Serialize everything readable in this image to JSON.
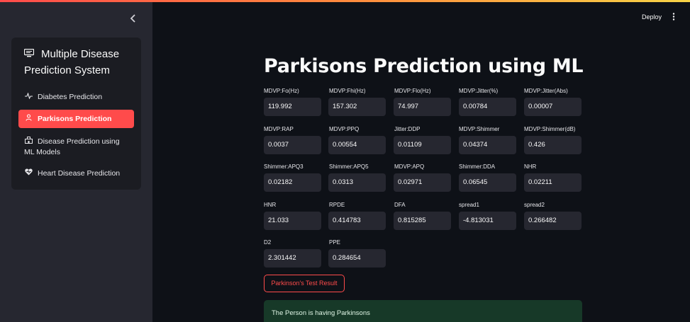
{
  "header": {
    "deploy_label": "Deploy",
    "menu_icon": "kebab-icon"
  },
  "sidebar": {
    "collapse_icon": "chevron-left-icon",
    "menu_title": "Multiple Disease Prediction System",
    "items": [
      {
        "label": "Diabetes Prediction",
        "icon": "activity-icon",
        "active": false
      },
      {
        "label": "Parkisons Prediction",
        "icon": "person-icon",
        "active": true
      },
      {
        "label": "Disease Prediction using ML Models",
        "icon": "hospital-icon",
        "active": false
      },
      {
        "label": "Heart Disease Prediction",
        "icon": "heart-icon",
        "active": false
      }
    ]
  },
  "main": {
    "title": "Parkisons Prediction using ML",
    "fields": [
      {
        "label": "MDVP:Fo(Hz)",
        "value": "119.992"
      },
      {
        "label": "MDVP:Fhi(Hz)",
        "value": "157.302"
      },
      {
        "label": "MDVP:Flo(Hz)",
        "value": "74.997"
      },
      {
        "label": "MDVP:Jitter(%)",
        "value": "0.00784"
      },
      {
        "label": "MDVP:Jitter(Abs)",
        "value": "0.00007"
      },
      {
        "label": "MDVP:RAP",
        "value": "0.0037"
      },
      {
        "label": "MDVP:PPQ",
        "value": "0.00554"
      },
      {
        "label": "Jitter:DDP",
        "value": "0.01109"
      },
      {
        "label": "MDVP:Shimmer",
        "value": "0.04374"
      },
      {
        "label": "MDVP:Shimmer(dB)",
        "value": "0.426"
      },
      {
        "label": "Shimmer:APQ3",
        "value": "0.02182"
      },
      {
        "label": "Shimmer:APQ5",
        "value": "0.0313"
      },
      {
        "label": "MDVP:APQ",
        "value": "0.02971"
      },
      {
        "label": "Shimmer:DDA",
        "value": "0.06545"
      },
      {
        "label": "NHR",
        "value": "0.02211"
      },
      {
        "label": "HNR",
        "value": "21.033"
      },
      {
        "label": "RPDE",
        "value": "0.414783"
      },
      {
        "label": "DFA",
        "value": "0.815285"
      },
      {
        "label": "spread1",
        "value": "-4.813031"
      },
      {
        "label": "spread2",
        "value": "0.266482"
      },
      {
        "label": "D2",
        "value": "2.301442"
      },
      {
        "label": "PPE",
        "value": "0.284654"
      }
    ],
    "result_button_label": "Parkinson's Test Result",
    "result_message": "The Person is having Parkinsons",
    "colors": {
      "accent": "#ff4b4b",
      "success_bg": "#173928",
      "sidebar_bg": "#262730",
      "page_bg": "#0e1117"
    }
  }
}
